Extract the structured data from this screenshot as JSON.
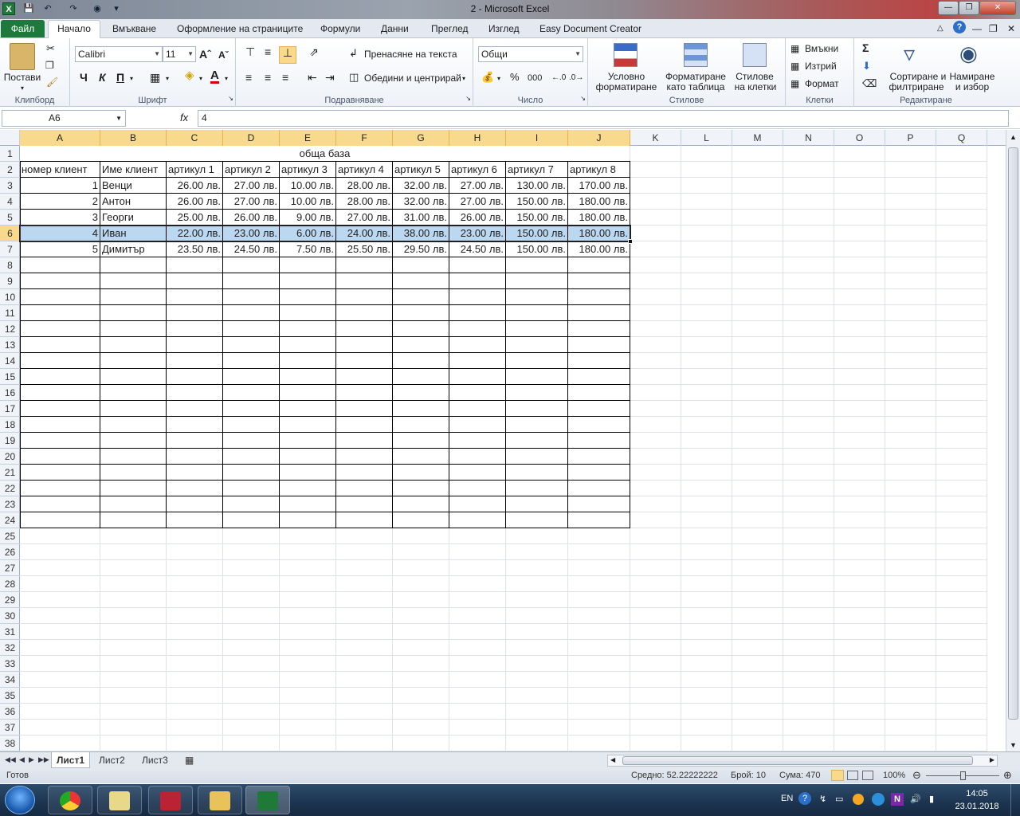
{
  "window": {
    "title": "2  -  Microsoft Excel"
  },
  "ribbon_tabs": [
    "Файл",
    "Начало",
    "Вмъкване",
    "Оформление на страниците",
    "Формули",
    "Данни",
    "Преглед",
    "Изглед",
    "Easy Document Creator"
  ],
  "ribbon": {
    "clipboard": {
      "paste": "Постави",
      "label": "Клипборд"
    },
    "font": {
      "name": "Calibri",
      "size": "11",
      "bold": "Ч",
      "italic": "К",
      "underline": "П",
      "label": "Шрифт"
    },
    "alignment": {
      "wrap": "Пренасяне на текста",
      "merge": "Обедини и центрирай",
      "label": "Подравняване"
    },
    "number": {
      "format": "Общи",
      "percent": "%",
      "thousands": "000",
      "label": "Число"
    },
    "styles": {
      "conditional_1": "Условно",
      "conditional_2": "форматиране",
      "table_1": "Форматиране",
      "table_2": "като таблица",
      "cell_1": "Стилове",
      "cell_2": "на клетки",
      "label": "Стилове"
    },
    "cells": {
      "insert": "Вмъкни",
      "delete": "Изтрий",
      "format": "Формат",
      "label": "Клетки"
    },
    "editing": {
      "sigma": "Σ",
      "sort_1": "Сортиране и",
      "sort_2": "филтриране",
      "find_1": "Намиране",
      "find_2": "и избор",
      "label": "Редактиране"
    }
  },
  "formula_bar": {
    "name_box": "A6",
    "fx": "fx",
    "value": "4"
  },
  "columns": [
    "A",
    "B",
    "C",
    "D",
    "E",
    "F",
    "G",
    "H",
    "I",
    "J",
    "K",
    "L",
    "M",
    "N",
    "O",
    "P",
    "Q"
  ],
  "rows_count": 38,
  "sheet": {
    "title": "обща база",
    "headers": [
      "номер клиент",
      "Име клиент",
      "артикул 1",
      "артикул 2",
      "артикул 3",
      "артикул 4",
      "артикул 5",
      "артикул 6",
      "артикул 7",
      "артикул 8"
    ],
    "data": [
      [
        "1",
        "Венци",
        "26.00 лв.",
        "27.00 лв.",
        "10.00 лв.",
        "28.00 лв.",
        "32.00 лв.",
        "27.00 лв.",
        "130.00 лв.",
        "170.00 лв."
      ],
      [
        "2",
        "Антон",
        "26.00 лв.",
        "27.00 лв.",
        "10.00 лв.",
        "28.00 лв.",
        "32.00 лв.",
        "27.00 лв.",
        "150.00 лв.",
        "180.00 лв."
      ],
      [
        "3",
        "Георги",
        "25.00 лв.",
        "26.00 лв.",
        "9.00 лв.",
        "27.00 лв.",
        "31.00 лв.",
        "26.00 лв.",
        "150.00 лв.",
        "180.00 лв."
      ],
      [
        "4",
        "Иван",
        "22.00 лв.",
        "23.00 лв.",
        "6.00 лв.",
        "24.00 лв.",
        "38.00 лв.",
        "23.00 лв.",
        "150.00 лв.",
        "180.00 лв."
      ],
      [
        "5",
        "Димитър",
        "23.50 лв.",
        "24.50 лв.",
        "7.50 лв.",
        "25.50 лв.",
        "29.50 лв.",
        "24.50 лв.",
        "150.00 лв.",
        "180.00 лв."
      ]
    ],
    "selected_row": 6
  },
  "sheet_tabs": [
    "Лист1",
    "Лист2",
    "Лист3"
  ],
  "status": {
    "ready": "Готов",
    "average": "Средно: 52.22222222",
    "count": "Брой: 10",
    "sum": "Сума: 470",
    "zoom": "100%"
  },
  "taskbar": {
    "lang": "EN",
    "time": "14:05",
    "date": "23.01.2018"
  }
}
